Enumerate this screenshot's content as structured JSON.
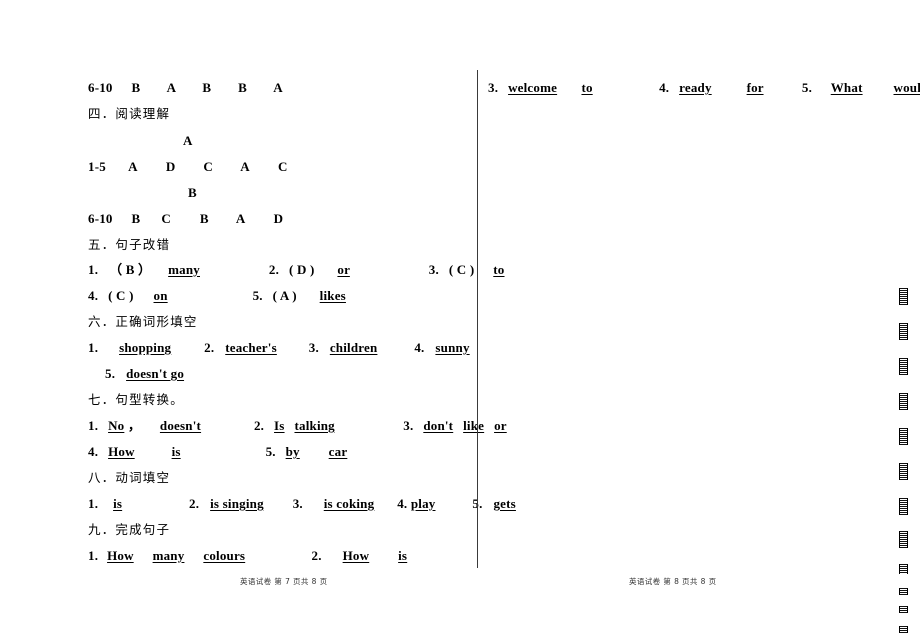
{
  "document": {
    "type": "exam-answer-key",
    "subject_footer_left": "英语试卷    第 7 页共 8 页",
    "subject_footer_right": "英语试卷    第 8 页共 8 页"
  },
  "left_column": {
    "listening_answers": {
      "range": "6-10",
      "answers": [
        "B",
        "A",
        "B",
        "B",
        "A"
      ]
    },
    "section_four": {
      "heading": "四．阅读理解",
      "passage_a_label": "A",
      "passage_a_range": "1-5",
      "passage_a_answers": [
        "A",
        "D",
        "C",
        "A",
        "C"
      ],
      "passage_b_label": "B",
      "passage_b_range": "6-10",
      "passage_b_answers": [
        "B",
        "C",
        "B",
        "A",
        "D"
      ]
    },
    "section_five": {
      "heading": "五．句子改错",
      "items": [
        {
          "num": "1.",
          "choice": "（   B  ）",
          "answer": "many"
        },
        {
          "num": "2.",
          "choice": "( D )",
          "answer": "or"
        },
        {
          "num": "3.",
          "choice": "( C )",
          "answer": "to"
        },
        {
          "num": "4.",
          "choice": "( C )",
          "answer": "on"
        },
        {
          "num": "5.",
          "choice": "( A )",
          "answer": "likes"
        }
      ]
    },
    "section_six": {
      "heading": "六．正确词形填空",
      "items": [
        {
          "num": "1.",
          "answer": "shopping"
        },
        {
          "num": "2.",
          "answer": "teacher's"
        },
        {
          "num": "3.",
          "answer": "children"
        },
        {
          "num": "4.",
          "answer": "sunny"
        },
        {
          "num": "5.",
          "answer": "doesn't go"
        }
      ]
    },
    "section_seven": {
      "heading": "七．句型转换。",
      "items": [
        {
          "num": "1.",
          "parts": [
            "No",
            "doesn't"
          ],
          "comma": "，"
        },
        {
          "num": "2.",
          "parts": [
            "Is",
            "talking"
          ]
        },
        {
          "num": "3.",
          "parts": [
            "don't",
            "like",
            "or"
          ]
        },
        {
          "num": "4.",
          "parts": [
            "How",
            "is"
          ]
        },
        {
          "num": "5.",
          "parts": [
            "by",
            "car"
          ]
        }
      ]
    },
    "section_eight": {
      "heading": "八．动词填空",
      "items": [
        {
          "num": "1.",
          "answer": "is"
        },
        {
          "num": "2.",
          "answer": "is singing"
        },
        {
          "num": "3.",
          "answer": "is coking"
        },
        {
          "num": "4.",
          "answer": "play"
        },
        {
          "num": "5.",
          "answer": "gets"
        }
      ]
    },
    "section_nine": {
      "heading": "九．完成句子",
      "items": [
        {
          "num": "1.",
          "parts": [
            "How",
            "many",
            "colours"
          ]
        },
        {
          "num": "2.",
          "parts": [
            "How",
            "is"
          ]
        }
      ]
    }
  },
  "right_column": {
    "items": [
      {
        "num": "3.",
        "parts": [
          "welcome",
          "to"
        ]
      },
      {
        "num": "4.",
        "parts": [
          "ready",
          "for"
        ]
      },
      {
        "num": "5.",
        "parts": [
          "What",
          "would"
        ]
      }
    ]
  }
}
